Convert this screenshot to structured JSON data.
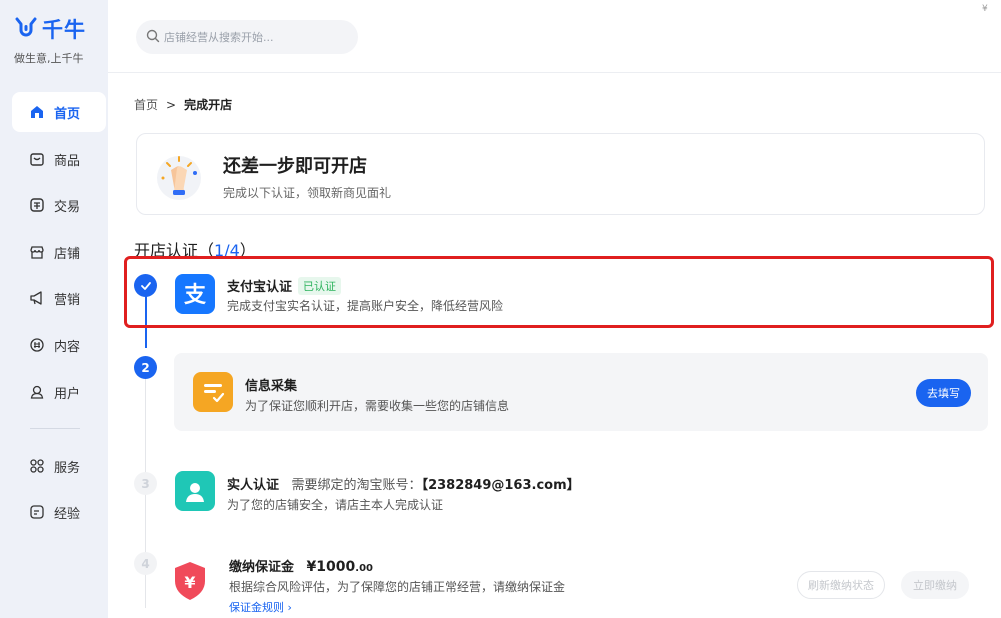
{
  "app": {
    "name": "千牛",
    "slogan": "做生意,上千牛"
  },
  "sidebar": {
    "items": [
      {
        "label": "首页",
        "icon": "home-icon"
      },
      {
        "label": "商品",
        "icon": "goods-icon"
      },
      {
        "label": "交易",
        "icon": "trade-icon"
      },
      {
        "label": "店铺",
        "icon": "store-icon"
      },
      {
        "label": "营销",
        "icon": "marketing-icon"
      },
      {
        "label": "内容",
        "icon": "content-icon"
      },
      {
        "label": "用户",
        "icon": "user-icon"
      },
      {
        "label": "服务",
        "icon": "service-icon"
      },
      {
        "label": "经验",
        "icon": "experience-icon"
      }
    ]
  },
  "search": {
    "placeholder": "店铺经营从搜索开始..."
  },
  "breadcrumb": {
    "home": "首页",
    "separator": ">",
    "current": "完成开店"
  },
  "hero": {
    "title": "还差一步即可开店",
    "subtitle": "完成以下认证，领取新商见面礼"
  },
  "section": {
    "title": "开店认证（",
    "count": "1/4",
    "close": "）"
  },
  "steps": [
    {
      "number": "",
      "title": "支付宝认证",
      "badge": "已认证",
      "desc": "完成支付宝实名认证，提高账户安全，降低经营风险",
      "status": "done",
      "icon": "alipay-icon"
    },
    {
      "number": "2",
      "title": "信息采集",
      "desc": "为了保证您顺利开店，需要收集一些您的店铺信息",
      "status": "active",
      "icon": "form-icon",
      "action": "去填写"
    },
    {
      "number": "3",
      "title": "实人认证",
      "extra_label": "需要绑定的淘宝账号：",
      "extra_value": "【2382849@163.com】",
      "desc": "为了您的店铺安全，请店主本人完成认证",
      "status": "pending",
      "icon": "person-icon"
    },
    {
      "number": "4",
      "title": "缴纳保证金",
      "amount": "¥1000",
      "amount_decimal": ".00",
      "desc": "根据综合风险评估，为了保障您的店铺正常经营，请缴纳保证金",
      "link": "保证金规则 ›",
      "status": "pending",
      "icon": "shield-yen-icon",
      "action_refresh": "刷新缴纳状态",
      "action_pay": "立即缴纳"
    }
  ],
  "colors": {
    "accent": "#1a64f0",
    "sidebar_bg": "#eef1f8",
    "success": "#2db35d",
    "highlight": "#e01f1f",
    "alipay": "#1677ff",
    "form_icon": "#f5a623",
    "person_icon": "#1fc7b6",
    "shield_icon": "#f04a5a"
  },
  "corner": "¥"
}
